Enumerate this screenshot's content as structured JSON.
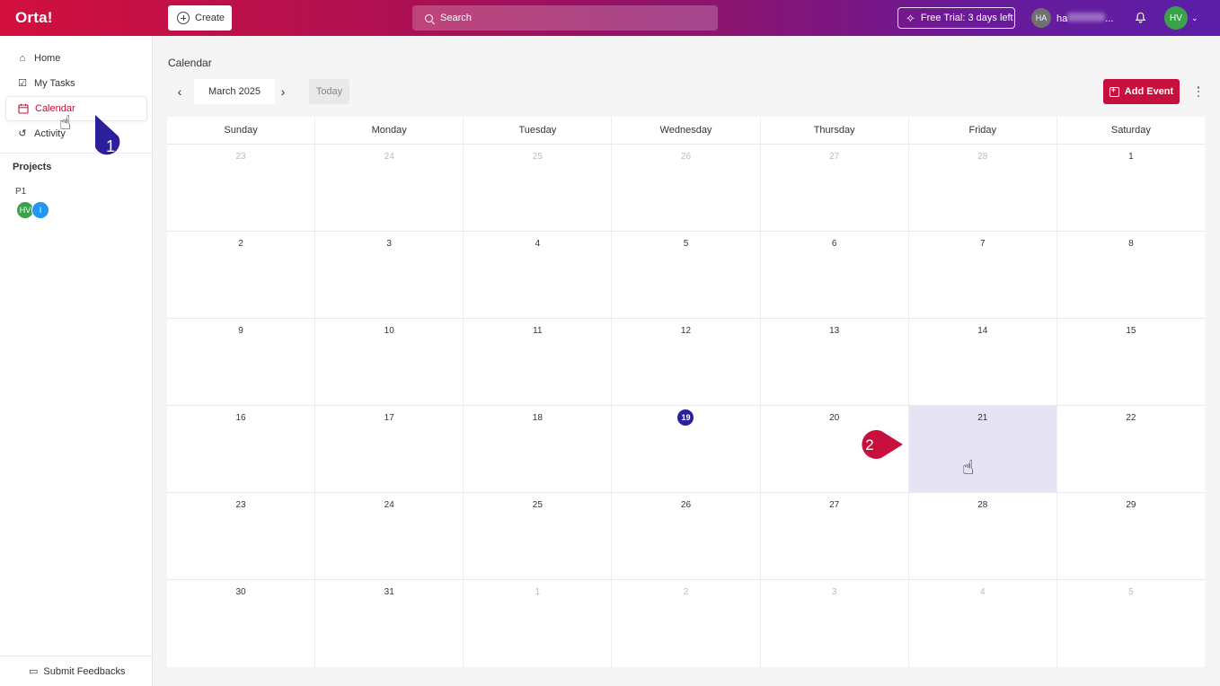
{
  "topbar": {
    "logo": "Orta!",
    "create_label": "Create",
    "search_placeholder": "Search",
    "trial_label": "Free Trial: 3 days left",
    "user_initials": "HA",
    "user_name_visible": "ha",
    "user_name_suffix": "...",
    "avatar_initials": "HV"
  },
  "sidebar": {
    "items": [
      {
        "label": "Home",
        "icon": "home-icon"
      },
      {
        "label": "My Tasks",
        "icon": "checkbox-icon"
      },
      {
        "label": "Calendar",
        "icon": "calendar-icon",
        "active": true
      },
      {
        "label": "Activity",
        "icon": "history-icon"
      }
    ],
    "projects_title": "Projects",
    "project": {
      "name": "P1",
      "members": [
        "HV",
        "I"
      ]
    },
    "feedback_label": "Submit Feedbacks"
  },
  "calendar": {
    "page_title": "Calendar",
    "month_label": "March 2025",
    "today_label": "Today",
    "add_event_label": "Add Event",
    "weekdays": [
      "Sunday",
      "Monday",
      "Tuesday",
      "Wednesday",
      "Thursday",
      "Friday",
      "Saturday"
    ],
    "weeks": [
      [
        {
          "d": "23",
          "m": true
        },
        {
          "d": "24",
          "m": true
        },
        {
          "d": "25",
          "m": true
        },
        {
          "d": "26",
          "m": true
        },
        {
          "d": "27",
          "m": true
        },
        {
          "d": "28",
          "m": true
        },
        {
          "d": "1"
        }
      ],
      [
        {
          "d": "2"
        },
        {
          "d": "3"
        },
        {
          "d": "4"
        },
        {
          "d": "5"
        },
        {
          "d": "6"
        },
        {
          "d": "7"
        },
        {
          "d": "8"
        }
      ],
      [
        {
          "d": "9"
        },
        {
          "d": "10"
        },
        {
          "d": "11"
        },
        {
          "d": "12"
        },
        {
          "d": "13"
        },
        {
          "d": "14"
        },
        {
          "d": "15"
        }
      ],
      [
        {
          "d": "16"
        },
        {
          "d": "17"
        },
        {
          "d": "18"
        },
        {
          "d": "19",
          "today": true
        },
        {
          "d": "20"
        },
        {
          "d": "21",
          "hl": true
        },
        {
          "d": "22"
        }
      ],
      [
        {
          "d": "23"
        },
        {
          "d": "24"
        },
        {
          "d": "25"
        },
        {
          "d": "26"
        },
        {
          "d": "27"
        },
        {
          "d": "28"
        },
        {
          "d": "29"
        }
      ],
      [
        {
          "d": "30"
        },
        {
          "d": "31"
        },
        {
          "d": "1",
          "m": true
        },
        {
          "d": "2",
          "m": true
        },
        {
          "d": "3",
          "m": true
        },
        {
          "d": "4",
          "m": true
        },
        {
          "d": "5",
          "m": true
        }
      ]
    ]
  },
  "annotations": {
    "step1": "1",
    "step2": "2"
  },
  "colors": {
    "accent": "#c8103e",
    "today": "#2b1f9c",
    "marker1": "#2b1f9c",
    "marker2": "#c8103e",
    "highlight": "#e6e4f4"
  }
}
